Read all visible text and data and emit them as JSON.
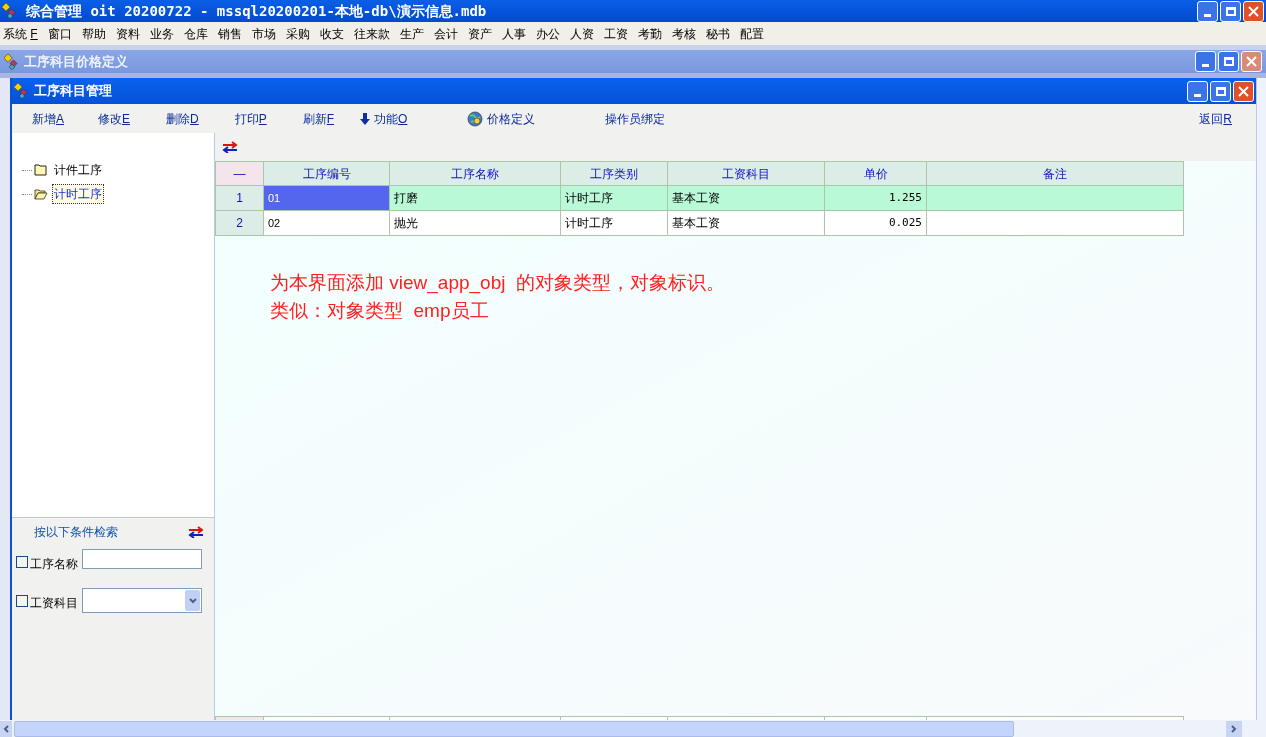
{
  "window": {
    "title": "综合管理 oit 20200722 - mssql20200201-本地-db\\演示信息.mdb"
  },
  "menu": [
    {
      "label": "系统",
      "key": "F"
    },
    {
      "label": "窗口"
    },
    {
      "label": "帮助"
    },
    {
      "label": "资料"
    },
    {
      "label": "业务"
    },
    {
      "label": "仓库"
    },
    {
      "label": "销售"
    },
    {
      "label": "市场"
    },
    {
      "label": "采购"
    },
    {
      "label": "收支"
    },
    {
      "label": "往来款"
    },
    {
      "label": "生产"
    },
    {
      "label": "会计"
    },
    {
      "label": "资产"
    },
    {
      "label": "人事"
    },
    {
      "label": "办公"
    },
    {
      "label": "人资"
    },
    {
      "label": "工资"
    },
    {
      "label": "考勤"
    },
    {
      "label": "考核"
    },
    {
      "label": "秘书"
    },
    {
      "label": "配置"
    }
  ],
  "outer_window": {
    "title": "工序科目价格定义"
  },
  "inner_window": {
    "title": "工序科目管理"
  },
  "toolbar": [
    {
      "kind": "text",
      "label": "新增",
      "key": "A"
    },
    {
      "kind": "text",
      "label": "修改",
      "key": "E"
    },
    {
      "kind": "text",
      "label": "删除",
      "key": "D"
    },
    {
      "kind": "text",
      "label": "打印",
      "key": "P"
    },
    {
      "kind": "text",
      "label": "刷新",
      "key": "F"
    },
    {
      "kind": "arrow",
      "label": "功能",
      "key": "O"
    },
    {
      "kind": "globe",
      "label": "价格定义"
    },
    {
      "kind": "text",
      "label": "操作员绑定"
    },
    {
      "kind": "spacer"
    },
    {
      "kind": "text",
      "label": "返回",
      "key": "R"
    }
  ],
  "tree": [
    {
      "label": "计件工序",
      "selected": false,
      "expanded": false
    },
    {
      "label": "计时工序",
      "selected": true,
      "expanded": true
    }
  ],
  "search": {
    "title": "按以下条件检索",
    "fields": [
      {
        "kind": "text",
        "label": "工序名称",
        "checked": false
      },
      {
        "kind": "select",
        "label": "工资科目",
        "checked": false
      }
    ]
  },
  "table": {
    "corner": "—",
    "columns": [
      "工序编号",
      "工序名称",
      "工序类别",
      "工资科目",
      "单价",
      "备注"
    ],
    "rows": [
      {
        "index": "1",
        "selected": true,
        "cells": [
          "01",
          "打磨",
          "计时工序",
          "基本工资",
          "1.255",
          ""
        ]
      },
      {
        "index": "2",
        "selected": false,
        "cells": [
          "02",
          "抛光",
          "计时工序",
          "基本工资",
          "0.025",
          ""
        ]
      }
    ]
  },
  "note": [
    "为本界面添加 view_app_obj  的对象类型，对象标识。",
    "类似：对象类型  emp员工"
  ]
}
